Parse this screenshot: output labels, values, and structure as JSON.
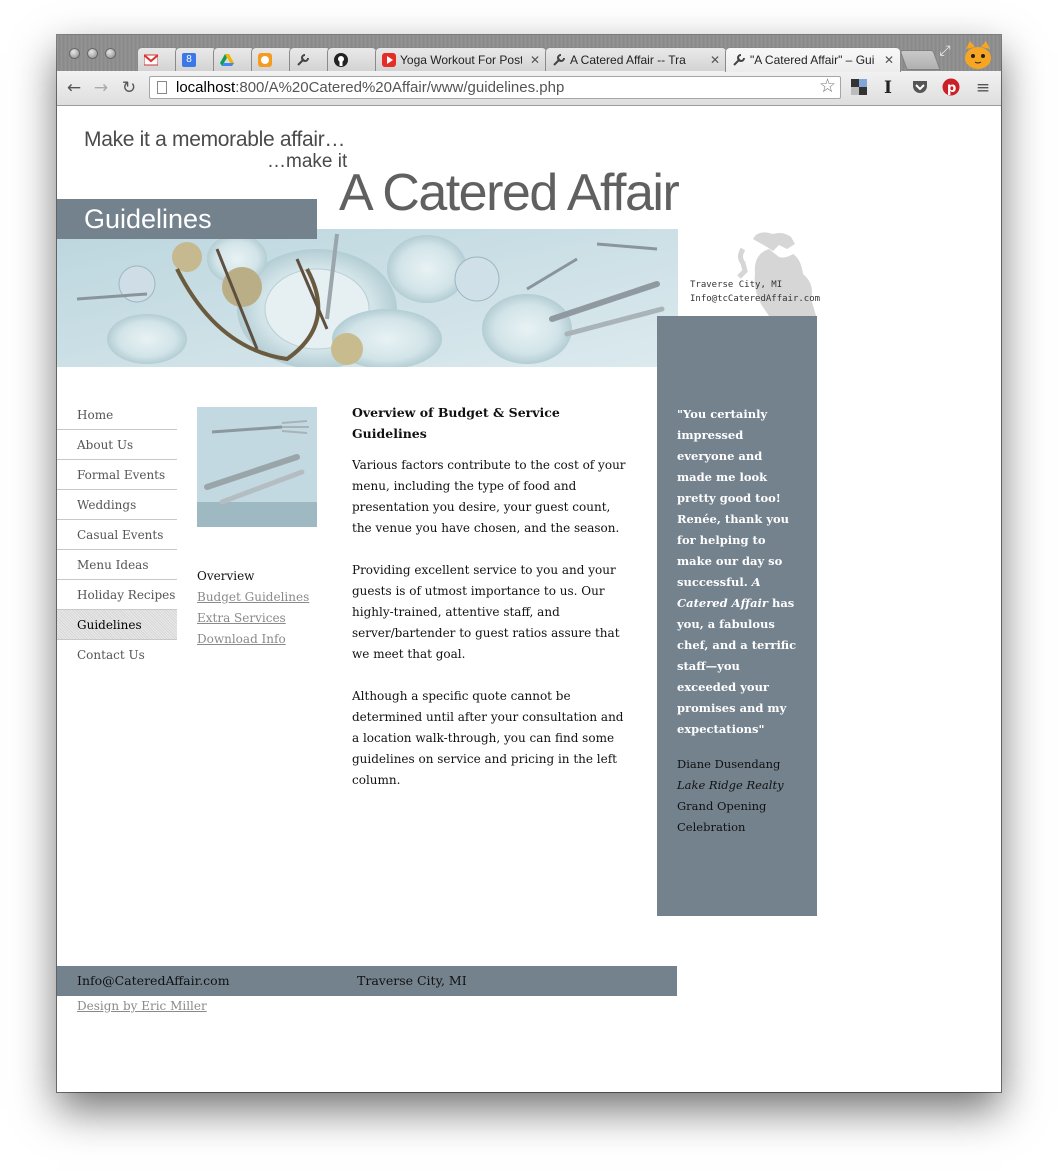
{
  "browser": {
    "tabs": [
      {
        "label": "",
        "icon": "gmail-icon"
      },
      {
        "label": "8",
        "icon": "calendar-icon"
      },
      {
        "label": "",
        "icon": "drive-icon"
      },
      {
        "label": "",
        "icon": "orange-app-icon"
      },
      {
        "label": "",
        "icon": "wrench-icon"
      },
      {
        "label": "",
        "icon": "github-icon"
      },
      {
        "label": "Yoga Workout For Post",
        "icon": "youtube-icon"
      },
      {
        "label": "A Catered Affair -- Tra",
        "icon": "wrench-icon"
      },
      {
        "label": "\"A Catered Affair\" – Gui",
        "icon": "wrench-icon"
      }
    ],
    "url_host": "localhost",
    "url_rest": ":800/A%20Catered%20Affair/www/guidelines.php"
  },
  "site": {
    "tagline_1": "Make it a memorable affair…",
    "tagline_2": "…make it",
    "brand": "A Catered Affair",
    "page_title": "Guidelines",
    "contact_city": "Traverse City, MI",
    "contact_email": "Info@tcCateredAffair.com"
  },
  "nav": {
    "items": [
      "Home",
      "About Us",
      "Formal Events",
      "Weddings",
      "Casual Events",
      "Menu Ideas",
      "Holiday Recipes",
      "Guidelines",
      "Contact Us"
    ],
    "active": "Guidelines"
  },
  "subnav": {
    "current": "Overview",
    "links": [
      "Budget Guidelines",
      "Extra Services",
      "Download Info"
    ]
  },
  "content": {
    "heading": "Overview of Budget & Service Guidelines",
    "paragraphs": [
      "Various factors contribute to the cost of your menu, including the type of food and presentation you desire, your guest count, the venue you have chosen, and the season.",
      "Providing excellent service to you and your guests is of utmost importance to us. Our highly-trained, attentive staff, and server/bartender to guest ratios assure that we meet that goal.",
      "Although a specific quote cannot be determined until after your consultation and a location walk-through, you can find some guidelines on service and pricing in the left column."
    ]
  },
  "quote": {
    "text_part1": "\"You certainly impressed everyone and made me look pretty good too! Renée, thank you for helping to make our day so successful. ",
    "text_em": "A Catered Affair",
    "text_part2": " has you, a fabulous chef, and a terrific staff—you exceeded your promises and my expectations\"",
    "author": "Diane Dusendang",
    "company": "Lake Ridge Realty",
    "event": "Grand Opening Celebration"
  },
  "footer": {
    "email": "Info@CateredAffair.com",
    "city": "Traverse City, MI",
    "credit": "Design by Eric Miller"
  },
  "colors": {
    "accent_slate": "#74828e",
    "link_gray": "#8a8a8a"
  }
}
